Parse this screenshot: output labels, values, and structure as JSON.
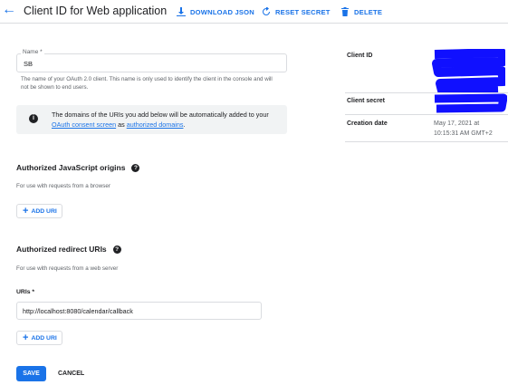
{
  "header": {
    "back_icon": "arrow-back-icon",
    "title": "Client ID for Web application",
    "download_label": "DOWNLOAD JSON",
    "reset_label": "RESET SECRET",
    "delete_label": "DELETE"
  },
  "name_field": {
    "label": "Name *",
    "value": "SB",
    "helper": "The name of your OAuth 2.0 client. This name is only used to identify the client in the console and will not be shown to end users."
  },
  "info_banner": {
    "icon": "info-icon",
    "text_before": "The domains of the URIs you add below will be automatically added to your ",
    "link1": "OAuth consent screen",
    "text_mid": " as ",
    "link2": "authorized domains",
    "text_after": "."
  },
  "js_origins": {
    "title": "Authorized JavaScript origins",
    "subtitle": "For use with requests from a browser",
    "add_label": "ADD URI"
  },
  "redirect_uris": {
    "title": "Authorized redirect URIs",
    "subtitle": "For use with requests from a web server",
    "uris_label": "URIs *",
    "uri_value": "http://localhost:8080/calendar/callback",
    "add_label": "ADD URI"
  },
  "actions": {
    "save_label": "SAVE",
    "cancel_label": "CANCEL"
  },
  "side_panel": {
    "client_id_label": "Client ID",
    "client_secret_label": "Client secret",
    "creation_label": "Creation date",
    "creation_date_line1": "May 17, 2021 at",
    "creation_date_line2": "10:15:31 AM GMT+2"
  },
  "colors": {
    "accent": "#1a73e8",
    "redaction": "#1010ff",
    "banner_bg": "#f1f3f4"
  }
}
